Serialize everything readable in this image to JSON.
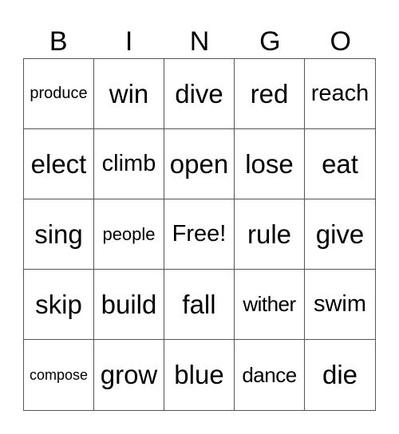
{
  "header": [
    "B",
    "I",
    "N",
    "G",
    "O"
  ],
  "cells": [
    [
      "produce",
      "win",
      "dive",
      "red",
      "reach"
    ],
    [
      "elect",
      "climb",
      "open",
      "lose",
      "eat"
    ],
    [
      "sing",
      "people",
      "Free!",
      "rule",
      "give"
    ],
    [
      "skip",
      "build",
      "fall",
      "wither",
      "swim"
    ],
    [
      "compose",
      "grow",
      "blue",
      "dance",
      "die"
    ]
  ]
}
